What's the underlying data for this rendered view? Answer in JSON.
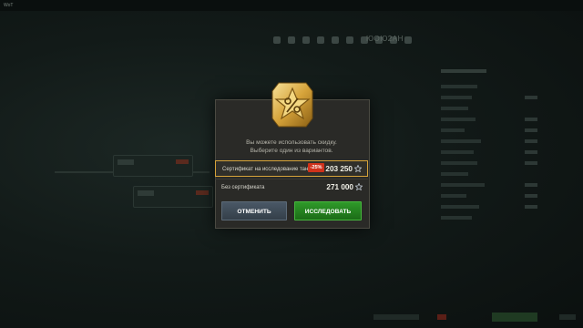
{
  "background": {
    "topbar": {
      "left_text": "WoT",
      "right_items": [
        "",
        "",
        "",
        ""
      ]
    },
    "nav_code": "ЮОЮ2АН"
  },
  "dialog": {
    "icon": "research-discount-star-icon",
    "prompt_line1": "Вы можете использовать скидку.",
    "prompt_line2": "Выберите один из вариантов.",
    "options": [
      {
        "label": "Сертификат на исследование танка",
        "discount": "-25%",
        "price": "203 250",
        "currency_icon": "experience-star-icon",
        "selected": true
      },
      {
        "label": "Без сертификата",
        "discount": "",
        "price": "271 000",
        "currency_icon": "experience-star-icon",
        "selected": false
      }
    ],
    "cancel_label": "ОТМЕНИТЬ",
    "research_label": "ИССЛЕДОВАТЬ"
  },
  "colors": {
    "accent_gold": "#d6a33a",
    "discount_red": "#d0321b",
    "research_green": "#2f9a2a",
    "cancel_slate": "#4a5866"
  }
}
